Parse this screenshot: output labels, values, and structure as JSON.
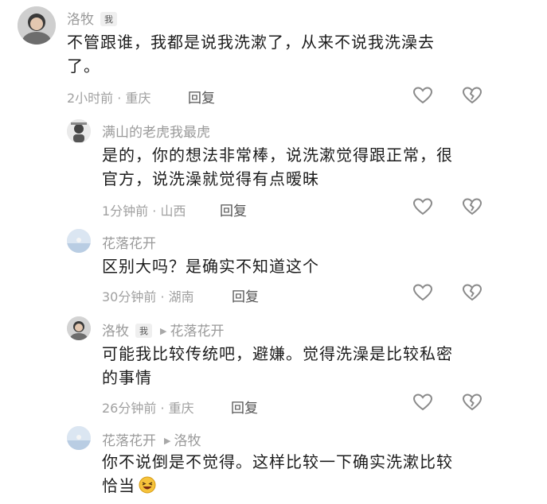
{
  "comments": [
    {
      "name": "洛牧",
      "badge": "我",
      "text_lines": [
        "不管跟谁，我都是说我洗漱了，从来不说我洗澡去",
        "了。"
      ],
      "time": "2小时前",
      "location": "重庆",
      "reply": "回复"
    },
    {
      "name": "满山的老虎我最虎",
      "text_lines": [
        "是的，你的想法非常棒，说洗漱觉得跟正常，很",
        "官方，说洗澡就觉得有点暧昧"
      ],
      "time": "1分钟前",
      "location": "山西",
      "reply": "回复"
    },
    {
      "name": "花落花开",
      "text_lines": [
        "区别大吗？是确实不知道这个"
      ],
      "time": "30分钟前",
      "location": "湖南",
      "reply": "回复"
    },
    {
      "name": "洛牧",
      "badge": "我",
      "reply_to": "花落花开",
      "text_lines": [
        "可能我比较传统吧，避嫌。觉得洗澡是比较私密",
        "的事情"
      ],
      "time": "26分钟前",
      "location": "重庆",
      "reply": "回复"
    },
    {
      "name": "花落花开",
      "reply_to": "洛牧",
      "text_lines": [
        "你不说倒是不觉得。这样比较一下确实洗漱比较",
        "恰当"
      ],
      "emoji": "laughing-emoji"
    }
  ],
  "meta_separator": " · "
}
